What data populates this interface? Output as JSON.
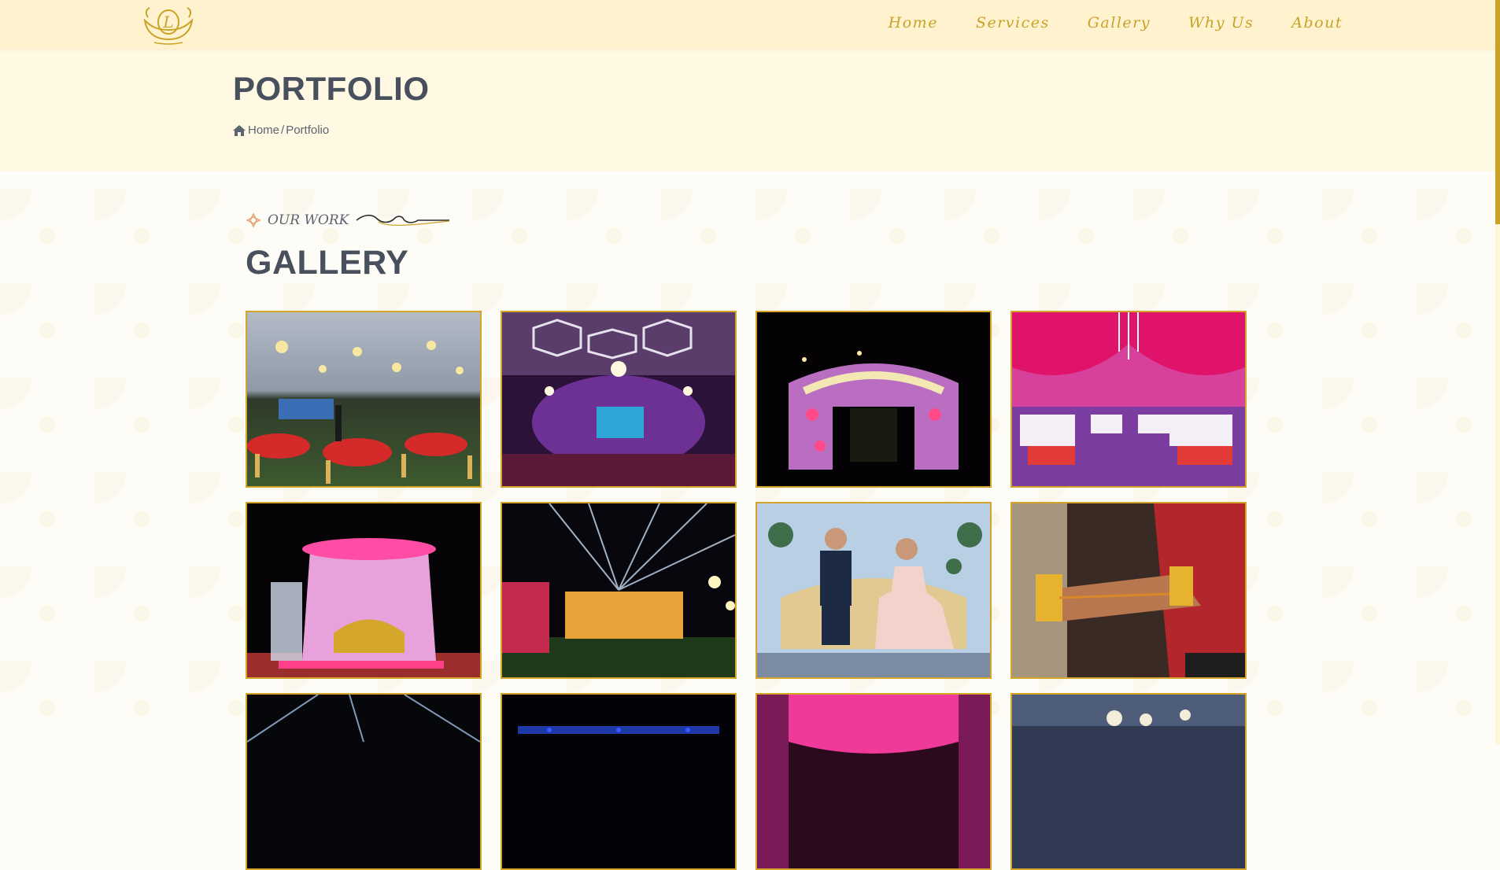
{
  "header": {
    "logo_alt": "Lotus logo",
    "nav": [
      "Home",
      "Services",
      "Gallery",
      "Why Us",
      "About"
    ]
  },
  "banner": {
    "title": "PORTFOLIO",
    "breadcrumb": {
      "home": "Home",
      "separator": "/",
      "current": "Portfolio"
    }
  },
  "gallery": {
    "eyebrow": "OUR WORK",
    "title": "GALLERY",
    "images": [
      {
        "name": "outdoor-lawn-dinner-setup",
        "scene": "lawn"
      },
      {
        "name": "banquet-hall-purple-lighting",
        "scene": "hall"
      },
      {
        "name": "floral-entrance-arch-night",
        "scene": "arch"
      },
      {
        "name": "pink-drape-dining-hall",
        "scene": "pinkhall"
      },
      {
        "name": "mandap-stage-pink-flowers",
        "scene": "mandap"
      },
      {
        "name": "outdoor-venue-light-beams",
        "scene": "beams"
      },
      {
        "name": "couple-on-golden-sofa",
        "scene": "couple"
      },
      {
        "name": "bridal-hands-henna",
        "scene": "hands"
      },
      {
        "name": "night-stage-spotlights",
        "scene": "spot"
      },
      {
        "name": "blue-stage-lights",
        "scene": "blue"
      },
      {
        "name": "pink-curtain-stage",
        "scene": "pinkstage"
      },
      {
        "name": "chandelier-hall",
        "scene": "chandelier"
      }
    ]
  },
  "colors": {
    "accent": "#c9a227",
    "heading": "#47505c",
    "header_bg": "#fff3cf"
  }
}
